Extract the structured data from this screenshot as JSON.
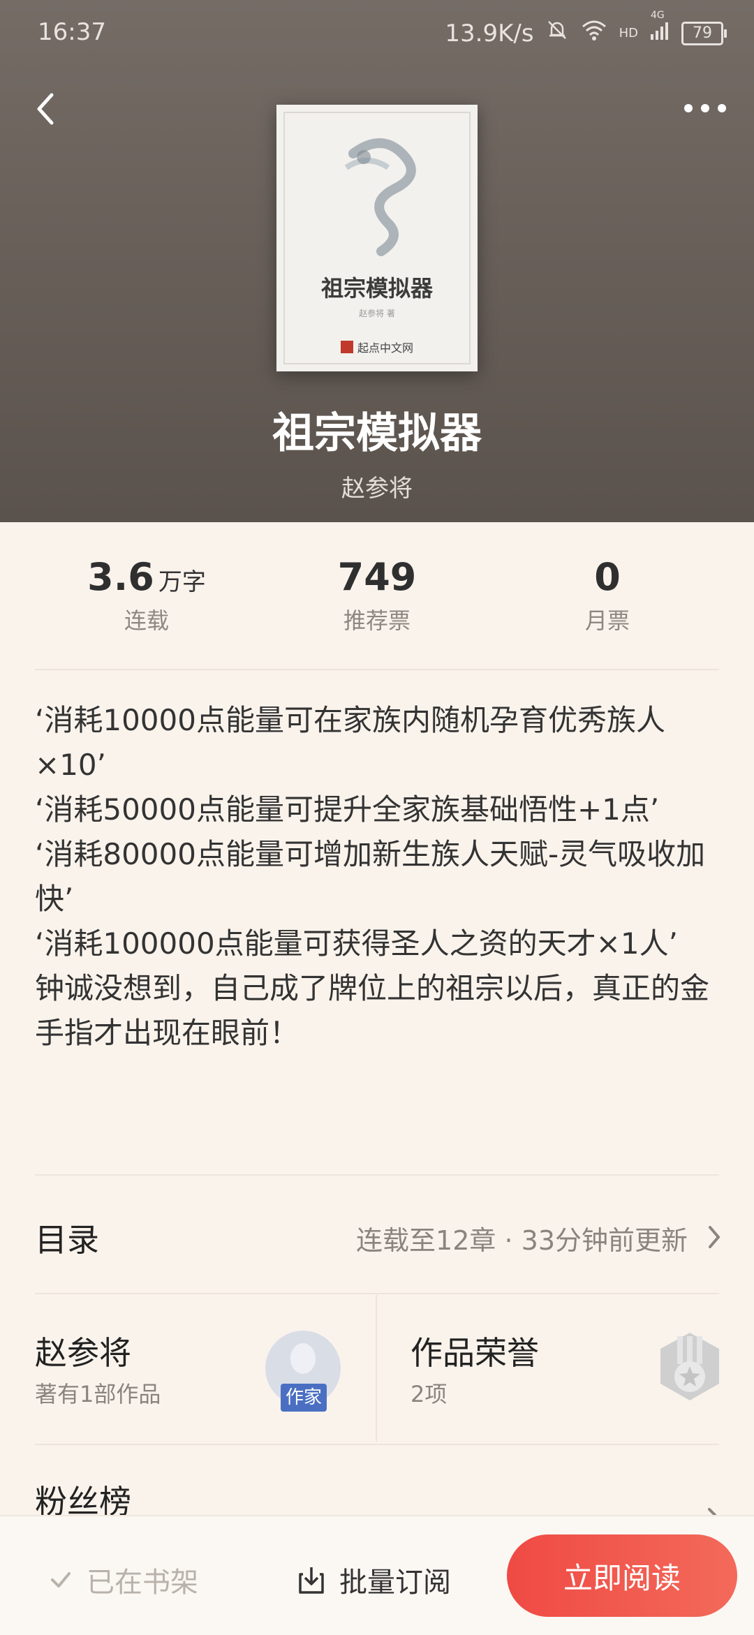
{
  "status_bar": {
    "time": "16:37",
    "network_speed": "13.9K/s",
    "network_badge": "HD",
    "network_type": "4G",
    "battery": "79"
  },
  "header": {
    "back_icon": "chevron-left-icon",
    "more_icon": "more-dots-icon"
  },
  "book": {
    "cover": {
      "title": "祖宗模拟器",
      "author": "赵参将 著",
      "publisher": "起点中文网"
    },
    "title": "祖宗模拟器",
    "author": "赵参将"
  },
  "stats": [
    {
      "value": "3.6",
      "unit": "万字",
      "label": "连载"
    },
    {
      "value": "749",
      "unit": "",
      "label": "推荐票"
    },
    {
      "value": "0",
      "unit": "",
      "label": "月票"
    }
  ],
  "description": [
    "‘消耗10000点能量可在家族内随机孕育优秀族人×10’",
    "‘消耗50000点能量可提升全家族基础悟性+1点’",
    "‘消耗80000点能量可增加新生族人天赋-灵气吸收加快’",
    "‘消耗100000点能量可获得圣人之资的天才×1人’",
    "钟诚没想到，自己成了牌位上的祖宗以后，真正的金手指才出现在眼前！"
  ],
  "toc": {
    "title": "目录",
    "status": "连载至12章 · 33分钟前更新"
  },
  "author_card": {
    "name": "赵参将",
    "works": "著有1部作品",
    "badge": "作家"
  },
  "honors": {
    "title": "作品荣誉",
    "count": "2项"
  },
  "fans": {
    "title": "粉丝榜"
  },
  "bottom_bar": {
    "shelf_label": "已在书架",
    "subscribe_label": "批量订阅",
    "read_label": "立即阅读"
  },
  "colors": {
    "accent": "#ef4a44",
    "header_bg": "#686059",
    "page_bg": "#faf3ec",
    "author_badge": "#4a6fc2"
  }
}
